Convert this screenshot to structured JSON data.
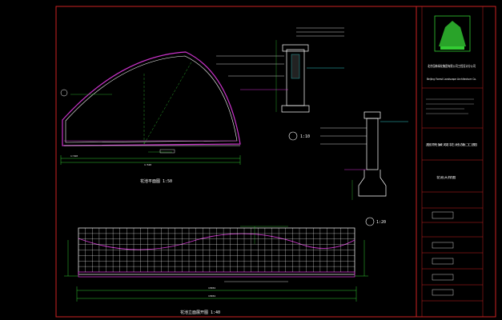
{
  "drawing": {
    "plan_title": "花池平面图 1:50",
    "elevation_title": "花池立面展开图 1:40",
    "detail1_scale": "1:10",
    "detail2_scale": "1:20",
    "plan_dims": {
      "inner": "1:520",
      "outer": "1:520"
    },
    "elevation_dims": {
      "inner": "13034",
      "outer": "13034"
    }
  },
  "title_block": {
    "company_cn": "北京园林绿化集团有限公司工程设计分公司",
    "company_en": "Beijing Forest Landscape Architecture Co.",
    "project_label": "庭院景观花池施工图",
    "sheet_label": "花池大样图"
  },
  "colors": {
    "background": "#000000",
    "frame": "#cc2222",
    "outline": "#ffffff",
    "magenta": "#cc33cc",
    "green": "#33cc33",
    "cyan": "#33cccc"
  }
}
